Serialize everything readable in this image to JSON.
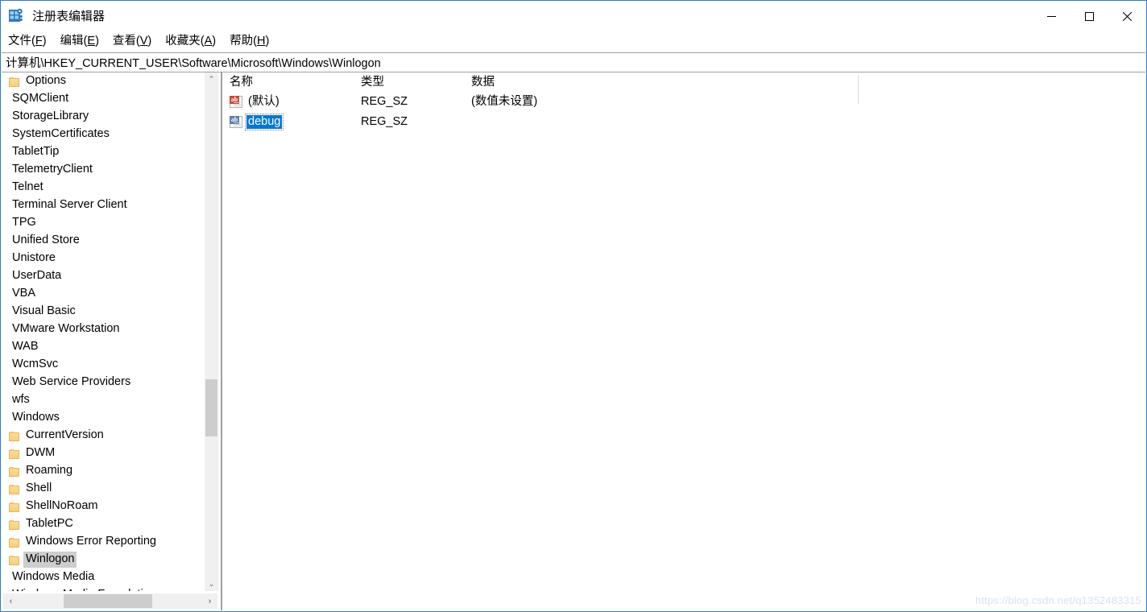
{
  "window": {
    "title": "注册表编辑器",
    "icon": "registry-editor-icon",
    "controls": {
      "minimize": "—",
      "maximize": "□",
      "close": "✕"
    }
  },
  "menubar": {
    "items": [
      {
        "label": "文件(F)",
        "text": "文件(",
        "accel": "F",
        "tail": ")"
      },
      {
        "label": "编辑(E)",
        "text": "编辑(",
        "accel": "E",
        "tail": ")"
      },
      {
        "label": "查看(V)",
        "text": "查看(",
        "accel": "V",
        "tail": ")"
      },
      {
        "label": "收藏夹(A)",
        "text": "收藏夹(",
        "accel": "A",
        "tail": ")"
      },
      {
        "label": "帮助(H)",
        "text": "帮助(",
        "accel": "H",
        "tail": ")"
      }
    ]
  },
  "address": {
    "path": "计算机\\HKEY_CURRENT_USER\\Software\\Microsoft\\Windows\\Winlogon"
  },
  "tree": {
    "items": [
      {
        "label": "Options",
        "indent": 1,
        "folder": true,
        "selected": false
      },
      {
        "label": "SQMClient",
        "indent": 0,
        "folder": false,
        "selected": false
      },
      {
        "label": "StorageLibrary",
        "indent": 0,
        "folder": false,
        "selected": false
      },
      {
        "label": "SystemCertificates",
        "indent": 0,
        "folder": false,
        "selected": false
      },
      {
        "label": "TabletTip",
        "indent": 0,
        "folder": false,
        "selected": false
      },
      {
        "label": "TelemetryClient",
        "indent": 0,
        "folder": false,
        "selected": false
      },
      {
        "label": "Telnet",
        "indent": 0,
        "folder": false,
        "selected": false
      },
      {
        "label": "Terminal Server Client",
        "indent": 0,
        "folder": false,
        "selected": false
      },
      {
        "label": "TPG",
        "indent": 0,
        "folder": false,
        "selected": false
      },
      {
        "label": "Unified Store",
        "indent": 0,
        "folder": false,
        "selected": false
      },
      {
        "label": "Unistore",
        "indent": 0,
        "folder": false,
        "selected": false
      },
      {
        "label": "UserData",
        "indent": 0,
        "folder": false,
        "selected": false
      },
      {
        "label": "VBA",
        "indent": 0,
        "folder": false,
        "selected": false
      },
      {
        "label": "Visual Basic",
        "indent": 0,
        "folder": false,
        "selected": false
      },
      {
        "label": "VMware Workstation",
        "indent": 0,
        "folder": false,
        "selected": false
      },
      {
        "label": "WAB",
        "indent": 0,
        "folder": false,
        "selected": false
      },
      {
        "label": "WcmSvc",
        "indent": 0,
        "folder": false,
        "selected": false
      },
      {
        "label": "Web Service Providers",
        "indent": 0,
        "folder": false,
        "selected": false
      },
      {
        "label": "wfs",
        "indent": 0,
        "folder": false,
        "selected": false
      },
      {
        "label": "Windows",
        "indent": 0,
        "folder": false,
        "selected": false
      },
      {
        "label": "CurrentVersion",
        "indent": 1,
        "folder": true,
        "selected": false
      },
      {
        "label": "DWM",
        "indent": 1,
        "folder": true,
        "selected": false
      },
      {
        "label": "Roaming",
        "indent": 1,
        "folder": true,
        "selected": false
      },
      {
        "label": "Shell",
        "indent": 1,
        "folder": true,
        "selected": false
      },
      {
        "label": "ShellNoRoam",
        "indent": 1,
        "folder": true,
        "selected": false
      },
      {
        "label": "TabletPC",
        "indent": 1,
        "folder": true,
        "selected": false
      },
      {
        "label": "Windows Error Reporting",
        "indent": 1,
        "folder": true,
        "selected": false
      },
      {
        "label": "Winlogon",
        "indent": 1,
        "folder": true,
        "selected": true
      },
      {
        "label": "Windows Media",
        "indent": 0,
        "folder": false,
        "selected": false
      },
      {
        "label": "Windows Media Foundation",
        "indent": 0,
        "folder": false,
        "selected": false
      }
    ],
    "vscroll": {
      "up": "⌃",
      "down": "⌄"
    },
    "hscroll": {
      "left": "‹",
      "right": "›"
    }
  },
  "values": {
    "columns": [
      {
        "label": "名称"
      },
      {
        "label": "类型"
      },
      {
        "label": "数据"
      }
    ],
    "rows": [
      {
        "icon": "string-value-icon-red",
        "name": "(默认)",
        "type": "REG_SZ",
        "data": "(数值未设置)",
        "editing": false
      },
      {
        "icon": "string-value-icon-blue",
        "name": "debug",
        "type": "REG_SZ",
        "data": "",
        "editing": true
      }
    ]
  },
  "watermark": {
    "text": "https://blog.csdn.net/q1352483315"
  }
}
